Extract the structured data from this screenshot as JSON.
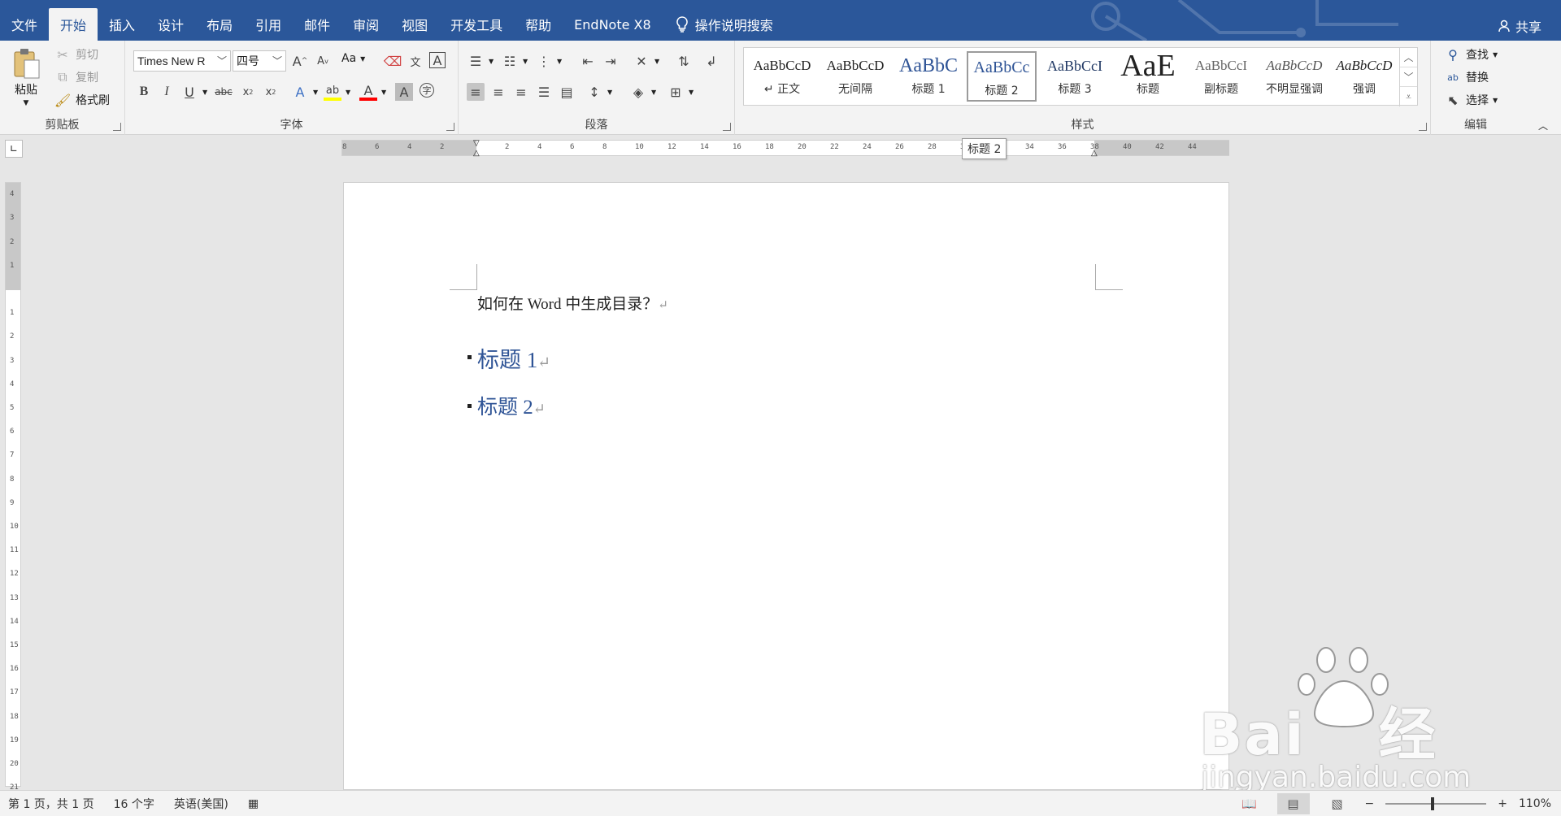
{
  "tabs": [
    {
      "label": "文件",
      "name": "tab-file"
    },
    {
      "label": "开始",
      "name": "tab-home",
      "active": true
    },
    {
      "label": "插入",
      "name": "tab-insert"
    },
    {
      "label": "设计",
      "name": "tab-design"
    },
    {
      "label": "布局",
      "name": "tab-layout"
    },
    {
      "label": "引用",
      "name": "tab-references"
    },
    {
      "label": "邮件",
      "name": "tab-mailings"
    },
    {
      "label": "审阅",
      "name": "tab-review"
    },
    {
      "label": "视图",
      "name": "tab-view"
    },
    {
      "label": "开发工具",
      "name": "tab-developer"
    },
    {
      "label": "帮助",
      "name": "tab-help"
    },
    {
      "label": "EndNote X8",
      "name": "tab-endnote"
    }
  ],
  "search_label": "操作说明搜索",
  "share_label": "共享",
  "clipboard": {
    "paste": "粘贴",
    "cut": "剪切",
    "copy": "复制",
    "format_painter": "格式刷",
    "group": "剪贴板"
  },
  "font": {
    "name": "Times New R",
    "size": "四号",
    "case_label": "Aa",
    "group": "字体"
  },
  "paragraph": {
    "group": "段落"
  },
  "styles": {
    "group": "样式",
    "items": [
      {
        "sample": "AaBbCcD",
        "name": "↵ 正文"
      },
      {
        "sample": "AaBbCcD",
        "name": "无间隔"
      },
      {
        "sample": "AaBbC",
        "name": "标题 1"
      },
      {
        "sample": "AaBbCc",
        "name": "标题 2",
        "active": true
      },
      {
        "sample": "AaBbCcI",
        "name": "标题 3"
      },
      {
        "sample": "AaE",
        "name": "标题"
      },
      {
        "sample": "AaBbCcI",
        "name": "副标题"
      },
      {
        "sample": "AaBbCcD",
        "name": "不明显强调"
      },
      {
        "sample": "AaBbCcD",
        "name": "强调"
      }
    ]
  },
  "editing": {
    "find": "查找",
    "replace": "替换",
    "select": "选择",
    "group": "编辑"
  },
  "style_tooltip": "标题 2",
  "document": {
    "line1": "如何在 Word 中生成目录？",
    "heading1": "标题 1",
    "heading2": "标题 2",
    "para_mark": "↵"
  },
  "status": {
    "page": "第 1 页，共 1 页",
    "words": "16 个字",
    "language": "英语(美国)",
    "zoom": "110%"
  },
  "zoom_fraction": 0.47,
  "colors": {
    "brand": "#2b579a",
    "heading": "#2f5496",
    "highlight": "#ffff00",
    "font_color": "#ff0000"
  }
}
